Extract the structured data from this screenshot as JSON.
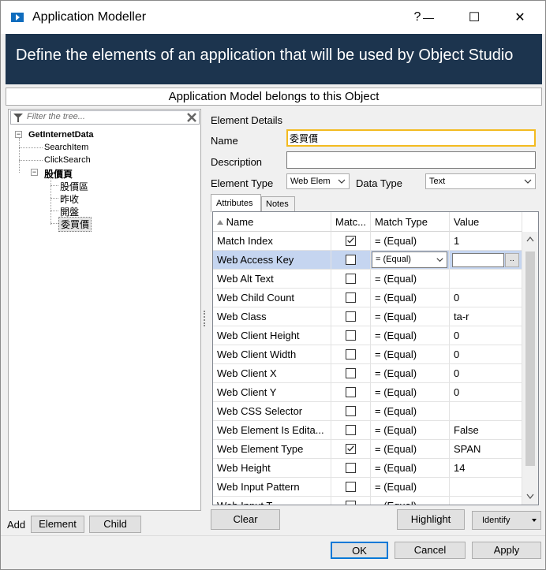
{
  "window": {
    "title": "Application Modeller",
    "help": "?",
    "minimize": "—",
    "maximize": "☐",
    "close": "✕"
  },
  "banner": {
    "text": "Define the elements of an application that will be used by Object Studio"
  },
  "belongs": {
    "label": "Application Model belongs to this Object"
  },
  "tree": {
    "filter_placeholder": "Filter the tree...",
    "root": "GetInternetData",
    "children": [
      "SearchItem",
      "ClickSearch"
    ],
    "group": "股價頁",
    "group_children": [
      "股價區",
      "昨收",
      "開盤",
      "委買價"
    ]
  },
  "add": {
    "label": "Add",
    "element": "Element",
    "child": "Child"
  },
  "details": {
    "heading": "Element Details",
    "name_label": "Name",
    "name_value": "委買價",
    "description_label": "Description",
    "description_value": "",
    "element_type_label": "Element Type",
    "element_type_value": "Web Elem",
    "data_type_label": "Data Type",
    "data_type_value": "Text"
  },
  "tabs": {
    "attributes": "Attributes",
    "notes": "Notes"
  },
  "grid": {
    "headers": {
      "name": "Name",
      "match": "Matc...",
      "match_type": "Match Type",
      "value": "Value"
    },
    "rows": [
      {
        "name": "Match Index",
        "checked": true,
        "match_type": "=  (Equal)",
        "value": "1"
      },
      {
        "name": "Web Access Key",
        "checked": false,
        "match_type": "=  (Equal)",
        "value": ""
      },
      {
        "name": "Web Alt Text",
        "checked": false,
        "match_type": "=  (Equal)",
        "value": ""
      },
      {
        "name": "Web Child Count",
        "checked": false,
        "match_type": "=  (Equal)",
        "value": "0"
      },
      {
        "name": "Web Class",
        "checked": false,
        "match_type": "=  (Equal)",
        "value": " ta-r"
      },
      {
        "name": "Web Client Height",
        "checked": false,
        "match_type": "=  (Equal)",
        "value": "0"
      },
      {
        "name": "Web Client Width",
        "checked": false,
        "match_type": "=  (Equal)",
        "value": "0"
      },
      {
        "name": "Web Client X",
        "checked": false,
        "match_type": "=  (Equal)",
        "value": "0"
      },
      {
        "name": "Web Client Y",
        "checked": false,
        "match_type": "=  (Equal)",
        "value": "0"
      },
      {
        "name": "Web CSS Selector",
        "checked": false,
        "match_type": "=  (Equal)",
        "value": ""
      },
      {
        "name": "Web Element Is Edita...",
        "checked": false,
        "match_type": "=  (Equal)",
        "value": "False"
      },
      {
        "name": "Web Element Type",
        "checked": true,
        "match_type": "=  (Equal)",
        "value": "SPAN"
      },
      {
        "name": "Web Height",
        "checked": false,
        "match_type": "=  (Equal)",
        "value": "14"
      },
      {
        "name": "Web Input Pattern",
        "checked": false,
        "match_type": "=  (Equal)",
        "value": ""
      },
      {
        "name": "Web Input T...",
        "checked": false,
        "match_type": "=  (Equal)",
        "value": ""
      }
    ],
    "selected_row": 1,
    "value_button": ".."
  },
  "buttons": {
    "clear": "Clear",
    "highlight": "Highlight",
    "identify": "Identify",
    "ok": "OK",
    "cancel": "Cancel",
    "apply": "Apply"
  },
  "colors": {
    "banner": "#1c344e",
    "selection": "#c5d5f0",
    "focus": "#f3bb20",
    "ok_border": "#0078d7"
  }
}
